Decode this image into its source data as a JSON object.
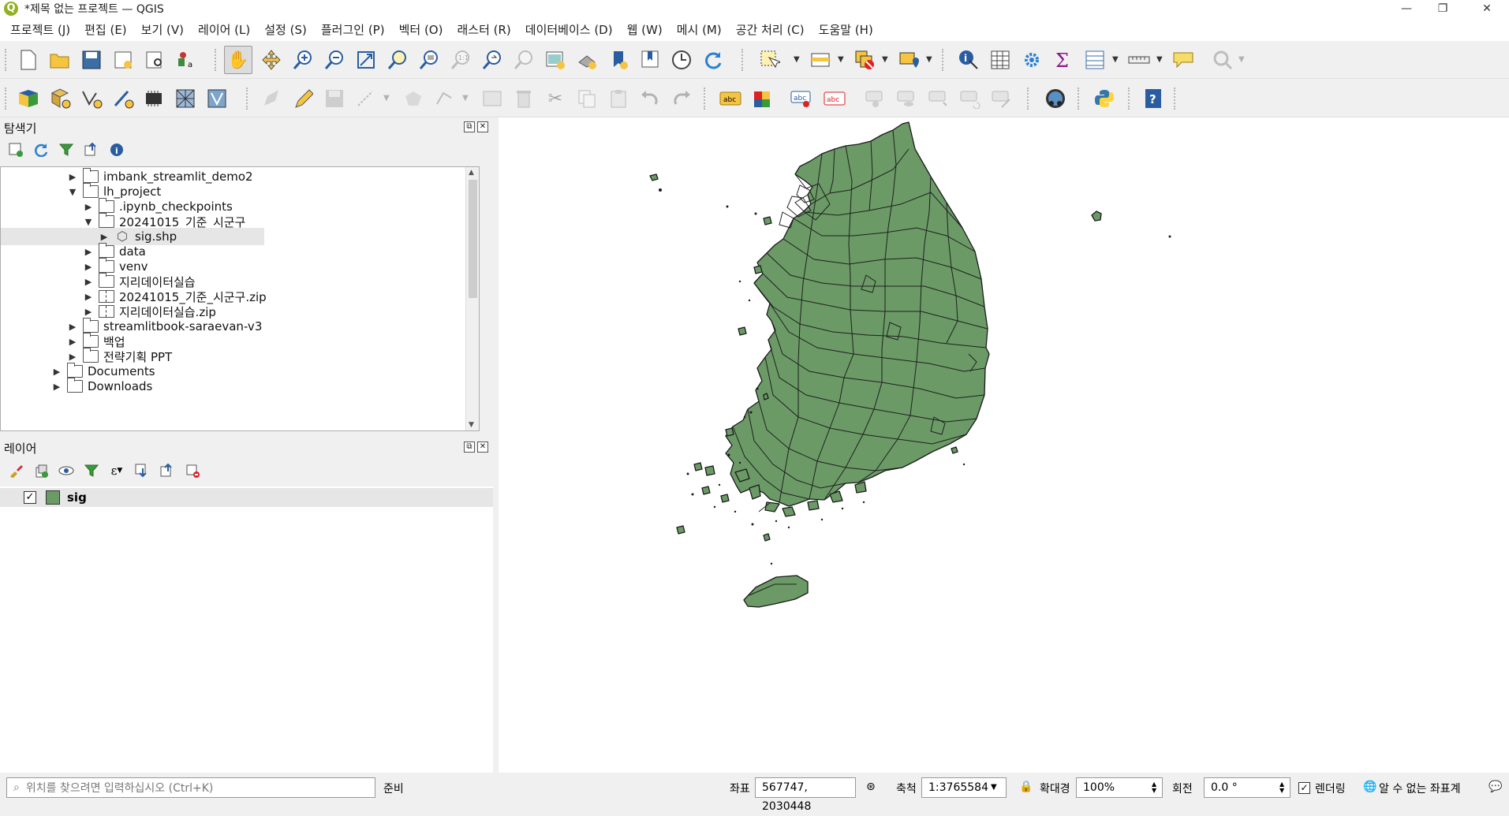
{
  "window": {
    "title": "*제목 없는 프로젝트 — QGIS",
    "logo": "Q"
  },
  "menu": [
    "프로젝트 (J)",
    "편집 (E)",
    "보기 (V)",
    "레이어 (L)",
    "설정 (S)",
    "플러그인 (P)",
    "벡터 (O)",
    "래스터 (R)",
    "데이터베이스 (D)",
    "웹 (W)",
    "메시 (M)",
    "공간 처리 (C)",
    "도움말 (H)"
  ],
  "browser": {
    "title": "탐색기",
    "tree": [
      {
        "label": "imbank_streamlit_demo2",
        "type": "folder",
        "expanded": false
      },
      {
        "label": "lh_project",
        "type": "folder",
        "expanded": true
      },
      {
        "label": ".ipynb_checkpoints",
        "type": "folder",
        "expanded": false
      },
      {
        "label": "20241015_기준_시군구",
        "type": "folder",
        "expanded": true
      },
      {
        "label": "sig.shp",
        "type": "shp",
        "expanded": false
      },
      {
        "label": "data",
        "type": "folder",
        "expanded": false
      },
      {
        "label": "venv",
        "type": "folder",
        "expanded": false
      },
      {
        "label": "지리데이터실습",
        "type": "folder",
        "expanded": false
      },
      {
        "label": "20241015_기준_시군구.zip",
        "type": "zip",
        "expanded": false
      },
      {
        "label": "지리데이터실습.zip",
        "type": "zip",
        "expanded": false
      },
      {
        "label": "streamlitbook-saraevan-v3",
        "type": "folder",
        "expanded": false
      },
      {
        "label": "백업",
        "type": "folder",
        "expanded": false
      },
      {
        "label": "전략기획 PPT",
        "type": "folder",
        "expanded": false
      },
      {
        "label": "Documents",
        "type": "folder",
        "expanded": false
      },
      {
        "label": "Downloads",
        "type": "folder",
        "expanded": false
      }
    ]
  },
  "layers": {
    "title": "레이어",
    "items": [
      {
        "label": "sig",
        "checked": true,
        "color": "#6b9a67"
      }
    ]
  },
  "status": {
    "search_placeholder": "위치를 찾으려면 입력하십시오 (Ctrl+K)",
    "ready": "준비",
    "coord_label": "좌표",
    "coord_value": "567747, 2030448",
    "scale_label": "축척",
    "scale_value": "1:3765584",
    "magnifier_label": "확대경",
    "magnifier_value": "100%",
    "rotation_label": "회전",
    "rotation_value": "0.0 °",
    "render_label": "렌더링",
    "crs_label": "알 수 없는 좌표계"
  },
  "colors": {
    "polygon_fill": "#6b9a67",
    "polygon_stroke": "#1a1a1a"
  }
}
